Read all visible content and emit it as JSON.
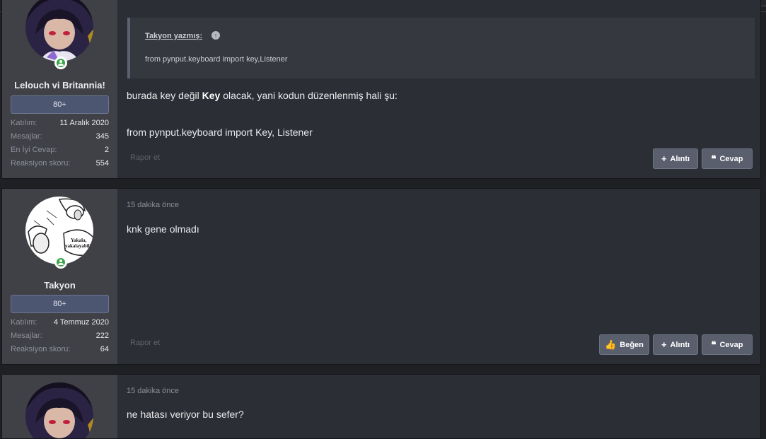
{
  "posts": [
    {
      "username": "Lelouch vi Britannia!",
      "badge": "80+",
      "stats": [
        {
          "label": "Katılım:",
          "value": "11 Aralık 2020"
        },
        {
          "label": "Mesajlar:",
          "value": "345"
        },
        {
          "label": "En İyi Cevap:",
          "value": "2"
        },
        {
          "label": "Reaksiyon skoru:",
          "value": "554"
        }
      ],
      "quote": {
        "author": "Takyon yazmış:",
        "text": "from pynput.keyboard import key,Listener"
      },
      "message_line1_before": "burada key değil ",
      "message_line1_bold": "Key",
      "message_line1_after": " olacak, yani kodun düzenlenmiş hali şu:",
      "message_line2": "from pynput.keyboard import Key, Listener",
      "report": "Rapor et",
      "buttons": {
        "quote": "Alıntı",
        "reply": "Cevap"
      }
    },
    {
      "username": "Takyon",
      "badge": "80+",
      "stats": [
        {
          "label": "Katılım:",
          "value": "4 Temmuz 2020"
        },
        {
          "label": "Mesajlar:",
          "value": "222"
        },
        {
          "label": "Reaksiyon skoru:",
          "value": "64"
        }
      ],
      "time": "15 dakika önce",
      "message": "knk gene olmadı",
      "avatar_text_1": "Yakala,",
      "avatar_text_2": "yakalayabilir",
      "report": "Rapor et",
      "buttons": {
        "like": "Beğen",
        "quote": "Alıntı",
        "reply": "Cevap"
      }
    },
    {
      "time": "15 dakika önce",
      "message": "ne hatası veriyor bu sefer?"
    }
  ],
  "icons": {
    "plus": "plus-icon",
    "quote_mark": "quote-mark-icon",
    "thumbs_up": "thumbs-up-icon",
    "online": "online-user-icon",
    "arrow_up": "arrow-up-circle-icon"
  },
  "colors": {
    "accent_button": "#5a5f6e",
    "online_green": "#3aa54a",
    "badge": "#4d5670"
  }
}
